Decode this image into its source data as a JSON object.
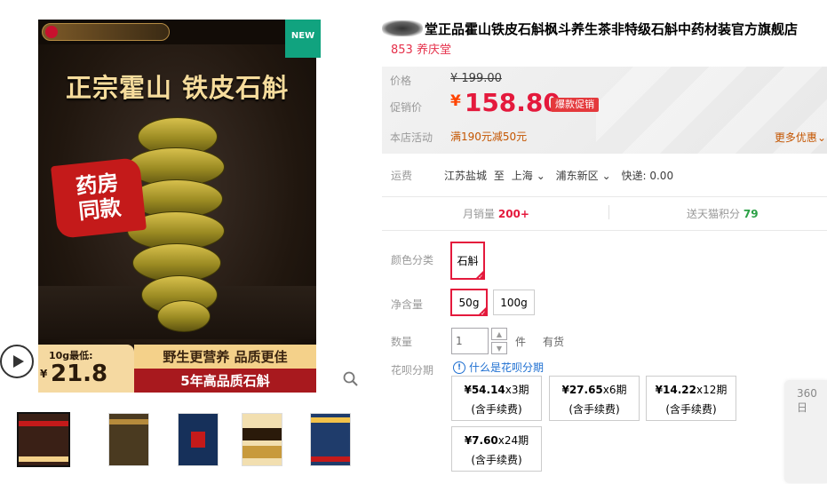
{
  "gallery": {
    "new_tag": "NEW",
    "headline": "正宗霍山 铁皮石斛",
    "stamp_line1": "药房",
    "stamp_line2": "同款",
    "price_label": "10g最低:",
    "price_currency": "¥",
    "price_value": "21.8",
    "slogan_top": "野生更营养 品质更佳",
    "slogan_bottom": "5年高品质石斛",
    "play_icon": "play-icon",
    "zoom_icon": "magnifier-icon",
    "thumbnails": [
      {
        "label": "thumb-1",
        "color": "#3a2016",
        "band": "#c41a1a"
      },
      {
        "label": "thumb-2",
        "color": "#4a3a20",
        "band": "#b68b3c"
      },
      {
        "label": "thumb-3",
        "color": "#16305a",
        "band": "#c41a1a"
      },
      {
        "label": "thumb-4",
        "color": "#f2dfb0",
        "band": "#2a1a0a"
      },
      {
        "label": "thumb-5",
        "color": "#1f3c6b",
        "band": "#f2c24a"
      }
    ]
  },
  "product": {
    "title": "堂正品霍山铁皮石斛枫斗养生茶非特级石斛中药材装官方旗舰店",
    "subtitle": "853 养庆堂"
  },
  "price_panel": {
    "price_label": "价格",
    "original_price": "¥ 199.00",
    "promo_label": "促销价",
    "promo_currency": "¥",
    "promo_price": "158.80",
    "promo_badge": "爆款促销",
    "activity_label": "本店活动",
    "activity_text": "满190元减50元",
    "more_discount": "更多优惠",
    "accent_color": "#e4193c"
  },
  "shipping": {
    "label": "运费",
    "origin": "江苏盐城",
    "to": "至",
    "city": "上海",
    "district": "浦东新区",
    "express": "快递: 0.00"
  },
  "stats": {
    "monthly_sales_label": "月销量",
    "monthly_sales_value": "200+",
    "points_label": "送天猫积分",
    "points_value": "79"
  },
  "options": {
    "color_label": "颜色分类",
    "color_values": [
      "石斛"
    ],
    "weight_label": "净含量",
    "weight_values": [
      "50g",
      "100g"
    ],
    "qty_label": "数量",
    "qty_value": "1",
    "qty_unit": "件",
    "qty_stock": "有货",
    "huabei_label": "花呗分期",
    "huabei_help": "什么是花呗分期",
    "huabei_plans": [
      {
        "amount": "¥54.14",
        "periods": "x3期",
        "fee": "(含手续费)"
      },
      {
        "amount": "¥27.65",
        "periods": "x6期",
        "fee": "(含手续费)"
      },
      {
        "amount": "¥14.22",
        "periods": "x12期",
        "fee": "(含手续费)"
      },
      {
        "amount": "¥7.60",
        "periods": "x24期",
        "fee": "(含手续费)"
      }
    ]
  },
  "floating": {
    "text": "360日"
  }
}
